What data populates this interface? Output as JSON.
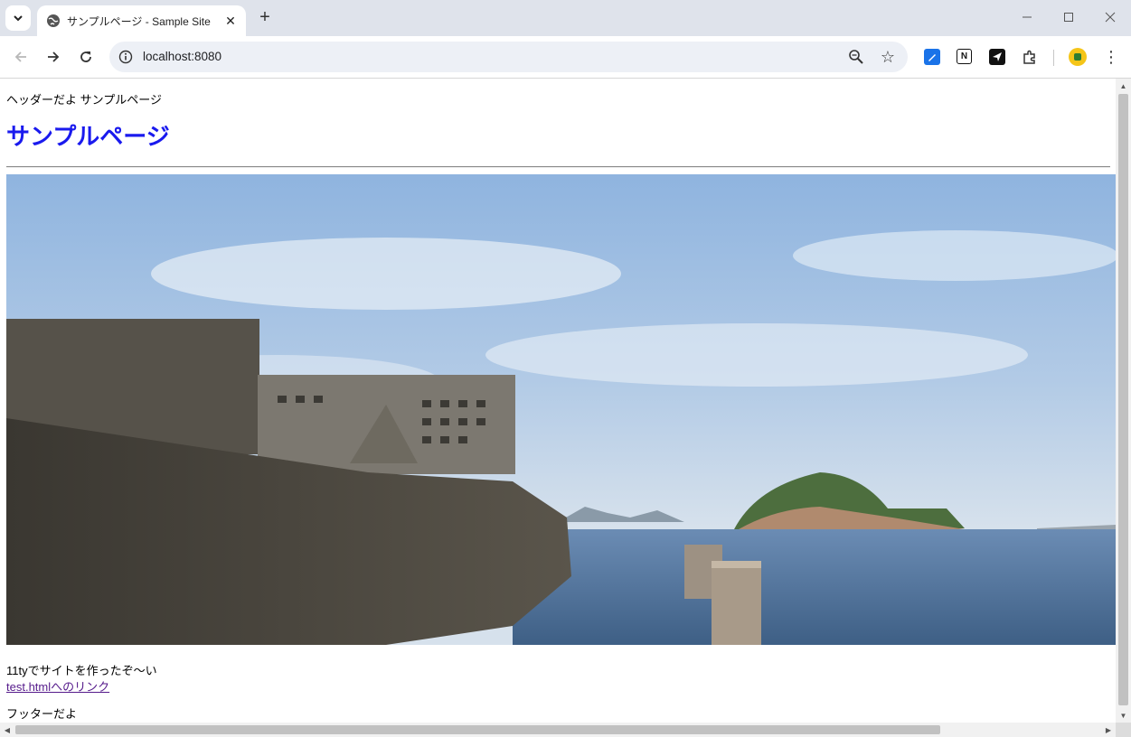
{
  "browser": {
    "tab": {
      "title": "サンプルページ - Sample Site",
      "close_glyph": "✕",
      "favicon": "globe-icon"
    },
    "tab_search_glyph": "⌄",
    "new_tab_glyph": "+",
    "window_controls": {
      "minimize": "─",
      "maximize": "☐",
      "close": "✕"
    },
    "nav": {
      "back": "←",
      "forward": "→",
      "reload": "↻"
    },
    "address_bar": {
      "url": "localhost:8080",
      "star_glyph": "☆"
    },
    "extensions": [
      "pencil-extension-icon",
      "notion-icon",
      "send-icon",
      "puzzle-extensions-icon"
    ],
    "menu_glyph": "⋮"
  },
  "page": {
    "header_text": "ヘッダーだよ サンプルページ",
    "heading": "サンプルページ",
    "image_alt": "",
    "body_text": "11tyでサイトを作ったぞ〜い",
    "link_text": "test.htmlへのリンク",
    "footer_text": "フッターだよ"
  },
  "colors": {
    "heading": "#1a1aee",
    "visited_link": "#551a8b",
    "tabstrip_bg": "#dfe3eb",
    "omnibox_bg": "#edf0f6"
  }
}
